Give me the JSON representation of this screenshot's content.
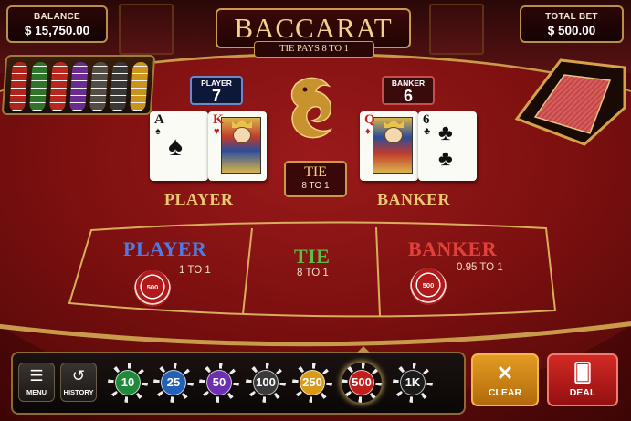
{
  "top": {
    "balance_label": "BALANCE",
    "balance_value": "$ 15,750.00",
    "total_bet_label": "TOTAL BET",
    "total_bet_value": "$ 500.00",
    "title": "BACCARAT",
    "subtitle": "TIE PAYS 8 TO 1"
  },
  "scores": {
    "player_label": "PLAYER",
    "player_value": "7",
    "banker_label": "BANKER",
    "banker_value": "6"
  },
  "hands": {
    "player_cards": [
      {
        "rank": "A",
        "suit": "♠",
        "color": "#111111"
      },
      {
        "rank": "K",
        "suit": "♥",
        "color": "#c41e1e"
      }
    ],
    "banker_cards": [
      {
        "rank": "Q",
        "suit": "♦",
        "color": "#c41e1e"
      },
      {
        "rank": "6",
        "suit": "♣",
        "color": "#111111"
      }
    ],
    "player_title": "PLAYER",
    "banker_title": "BANKER",
    "tie_title": "TIE",
    "tie_odds": "8 TO 1"
  },
  "zones": {
    "player": {
      "label": "PLAYER",
      "odds": "1 TO 1",
      "color": "#4c7de6",
      "chip": "500"
    },
    "tie": {
      "label": "TIE",
      "odds": "8 TO 1",
      "color": "#5bbf4a"
    },
    "banker": {
      "label": "BANKER",
      "odds": "0.95 TO 1",
      "color": "#e0413a",
      "chip": "500"
    }
  },
  "controls": {
    "menu_label": "MENU",
    "history_label": "HISTORY",
    "chips": [
      {
        "value": "10",
        "color": "#1f8a3a"
      },
      {
        "value": "25",
        "color": "#2460b8"
      },
      {
        "value": "50",
        "color": "#6b2fb0"
      },
      {
        "value": "100",
        "color": "#3a3a3a"
      },
      {
        "value": "250",
        "color": "#d99a1a"
      },
      {
        "value": "500",
        "color": "#c21d1d"
      },
      {
        "value": "1K",
        "color": "#1b1b1b"
      }
    ],
    "selected_chip": "500",
    "clear_label": "CLEAR",
    "deal_label": "DEAL"
  },
  "icons": {
    "menu": "hamburger-icon",
    "history": "history-icon",
    "clear": "close-icon",
    "deal": "cards-icon"
  }
}
